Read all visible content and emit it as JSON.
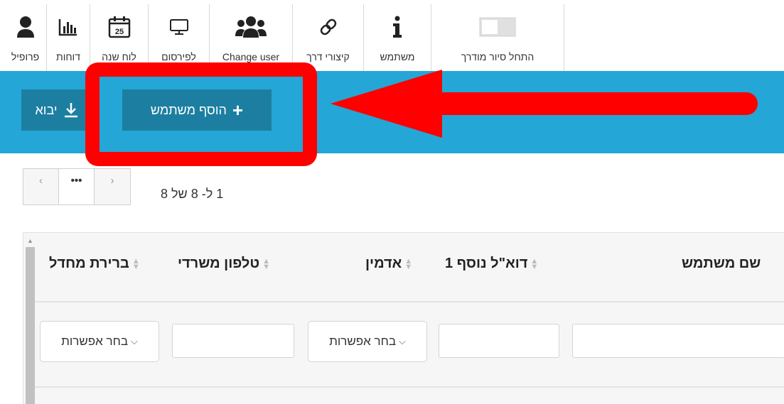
{
  "toolbar": {
    "items": [
      {
        "label": "פרופיל",
        "icon": "user-icon"
      },
      {
        "label": "דוחות",
        "icon": "bar-chart-icon"
      },
      {
        "label": "לוח שנה",
        "icon": "calendar-icon",
        "icon_text": "25"
      },
      {
        "label": "לפירסום",
        "icon": "monitor-icon"
      },
      {
        "label": "Change user",
        "icon": "users-icon"
      },
      {
        "label": "קיצורי דרך",
        "icon": "link-icon"
      },
      {
        "label": "משתמש",
        "icon": "info-icon"
      },
      {
        "label": "התחל סיור מודרך",
        "icon": "toggle-switch-icon"
      }
    ]
  },
  "actions": {
    "add_user_label": "הוסף משתמש",
    "add_user_icon": "+",
    "import_label": "יבוא"
  },
  "pagination": {
    "prev": "‹",
    "current": "•••",
    "next": "›",
    "info": "1 ל- 8 של 8"
  },
  "table": {
    "headers": [
      {
        "label": "שם משתמש"
      },
      {
        "label": "דוא\"ל נוסף 1"
      },
      {
        "label": "אדמין"
      },
      {
        "label": "טלפון משרדי"
      },
      {
        "label": "ברירת מחדל"
      }
    ],
    "filters": {
      "admin_select": "בחר אפשרות",
      "default_select": "בחר אפשרות"
    }
  },
  "colors": {
    "action_bar": "#24a6d6",
    "button": "#1c7fa1",
    "highlight": "#ff0000"
  }
}
